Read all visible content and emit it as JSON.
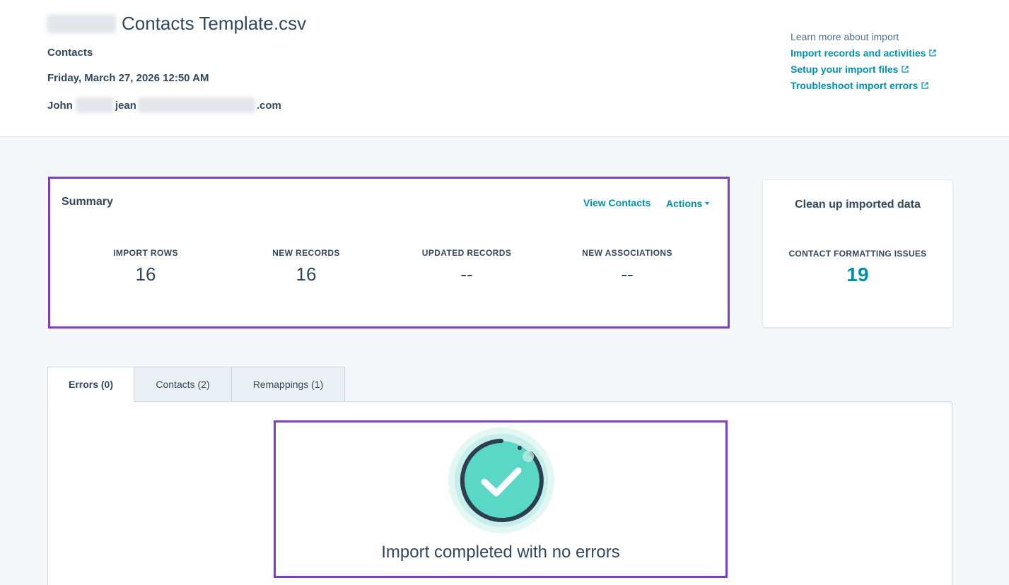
{
  "header": {
    "file_name": "Contacts Template.csv",
    "object_type": "Contacts",
    "date": "Friday, March 27, 2026 12:50 AM",
    "user_first": "John",
    "email_start": "jean",
    "email_end": ".com"
  },
  "learn": {
    "title": "Learn more about import",
    "links": [
      "Import records and activities",
      "Setup your import files",
      "Troubleshoot import errors"
    ]
  },
  "summary": {
    "title": "Summary",
    "view_contacts": "View Contacts",
    "actions": "Actions",
    "stats": [
      {
        "label": "IMPORT ROWS",
        "value": "16"
      },
      {
        "label": "NEW RECORDS",
        "value": "16"
      },
      {
        "label": "UPDATED RECORDS",
        "value": "--"
      },
      {
        "label": "NEW ASSOCIATIONS",
        "value": "--"
      }
    ]
  },
  "cleanup": {
    "title": "Clean up imported data",
    "label": "CONTACT FORMATTING ISSUES",
    "value": "19"
  },
  "tabs": [
    {
      "label": "Errors (0)",
      "active": true
    },
    {
      "label": "Contacts (2)",
      "active": false
    },
    {
      "label": "Remappings (1)",
      "active": false
    }
  ],
  "result": {
    "message": "Import completed with no errors"
  },
  "colors": {
    "accent": "#0091ae",
    "highlight": "#7b3fc7",
    "text": "#33475b",
    "success": "#5ad7c5"
  }
}
